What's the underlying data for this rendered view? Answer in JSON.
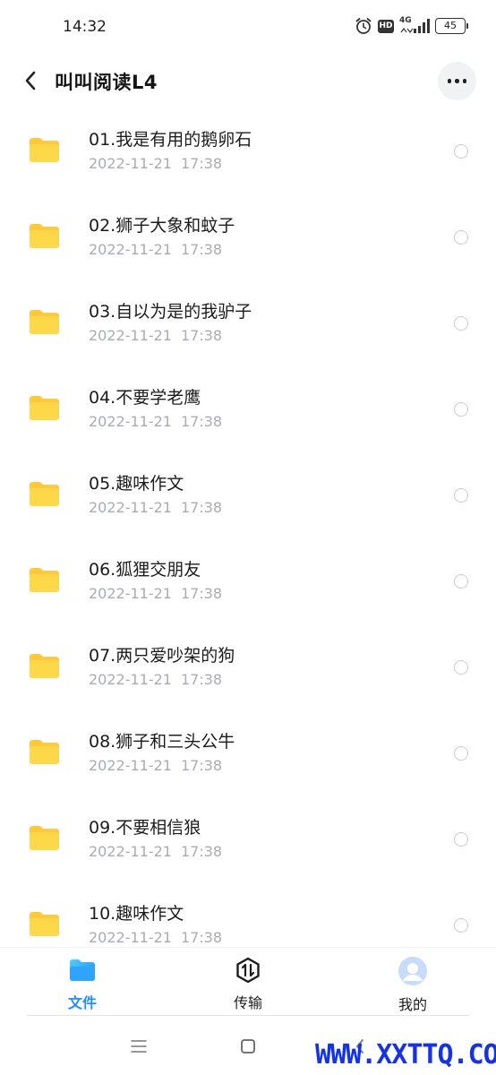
{
  "status_bar": {
    "time": "14:32",
    "network": "4G",
    "hd_label": "HD",
    "battery": "45",
    "icons": [
      "alarm-icon",
      "hd-icon",
      "signal-icon",
      "battery-icon"
    ]
  },
  "header": {
    "title": "叫叫阅读L4",
    "back_icon": "chevron-left-icon",
    "more_icon": "more-horizontal-icon"
  },
  "files": [
    {
      "name": "01.我是有用的鹅卵石",
      "date": "2022-11-21",
      "time": "17:38"
    },
    {
      "name": "02.狮子大象和蚊子",
      "date": "2022-11-21",
      "time": "17:38"
    },
    {
      "name": "03.自以为是的我驴子",
      "date": "2022-11-21",
      "time": "17:38"
    },
    {
      "name": "04.不要学老鹰",
      "date": "2022-11-21",
      "time": "17:38"
    },
    {
      "name": "05.趣味作文",
      "date": "2022-11-21",
      "time": "17:38"
    },
    {
      "name": "06.狐狸交朋友",
      "date": "2022-11-21",
      "time": "17:38"
    },
    {
      "name": "07.两只爱吵架的狗",
      "date": "2022-11-21",
      "time": "17:38"
    },
    {
      "name": "08.狮子和三头公牛",
      "date": "2022-11-21",
      "time": "17:38"
    },
    {
      "name": "09.不要相信狼",
      "date": "2022-11-21",
      "time": "17:38"
    },
    {
      "name": "10.趣味作文",
      "date": "2022-11-21",
      "time": "17:38"
    }
  ],
  "bottom_nav": {
    "tabs": [
      {
        "label": "文件",
        "icon": "folder-icon",
        "active": true
      },
      {
        "label": "传输",
        "icon": "transfer-icon",
        "active": false
      },
      {
        "label": "我的",
        "icon": "avatar-icon",
        "active": false
      }
    ]
  },
  "system_nav": {
    "icons": [
      "menu-icon",
      "home-square-icon",
      "back-chevron-icon"
    ]
  },
  "watermark": "WWW.XXTTQ.COM",
  "colors": {
    "accent": "#1f8fff",
    "folder": "#ffd84a",
    "folder_back": "#ffc93a",
    "secondary_text": "#a9acb2",
    "watermark": "#1533e6"
  }
}
